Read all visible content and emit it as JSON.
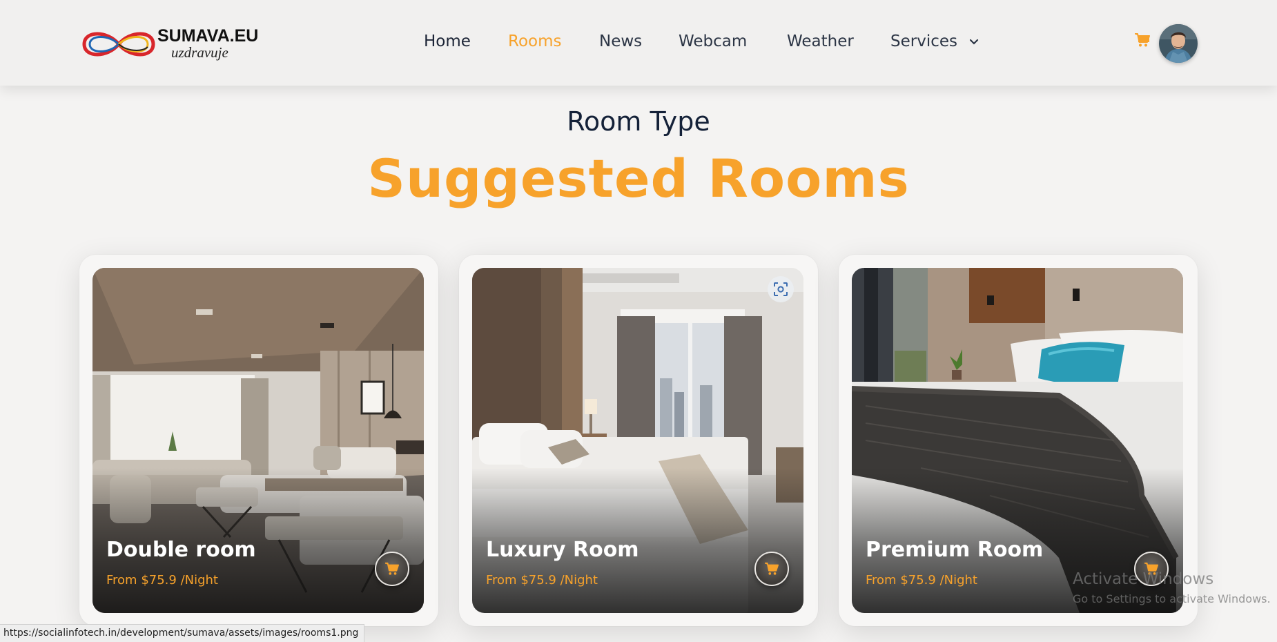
{
  "brand": {
    "name": "SUMAVA.EU",
    "tagline": "uzdravuje"
  },
  "nav": {
    "items": [
      {
        "label": "Home"
      },
      {
        "label": "Rooms"
      },
      {
        "label": "News"
      },
      {
        "label": "Webcam"
      },
      {
        "label": "Weather"
      },
      {
        "label": "Services"
      }
    ],
    "active": "Rooms",
    "services_icon": "chevron-down-icon"
  },
  "header_actions": {
    "cart_icon": "cart-icon",
    "avatar_icon": "user-avatar"
  },
  "section": {
    "eyebrow": "Room Type",
    "title": "Suggested Rooms"
  },
  "rooms": [
    {
      "name": "Double room",
      "price": "From $75.9 /Night"
    },
    {
      "name": "Luxury Room",
      "price": "From $75.9 /Night"
    },
    {
      "name": "Premium Room",
      "price": "From $75.9 /Night"
    }
  ],
  "overlays": {
    "activate_title": "Activate Windows",
    "activate_sub": "Go to Settings to activate Windows.",
    "status_url": "https://socialinfotech.in/development/sumava/assets/images/rooms1.png"
  },
  "colors": {
    "accent": "#f7a22b",
    "dark_text": "#142138",
    "background": "#f4f3f2"
  }
}
